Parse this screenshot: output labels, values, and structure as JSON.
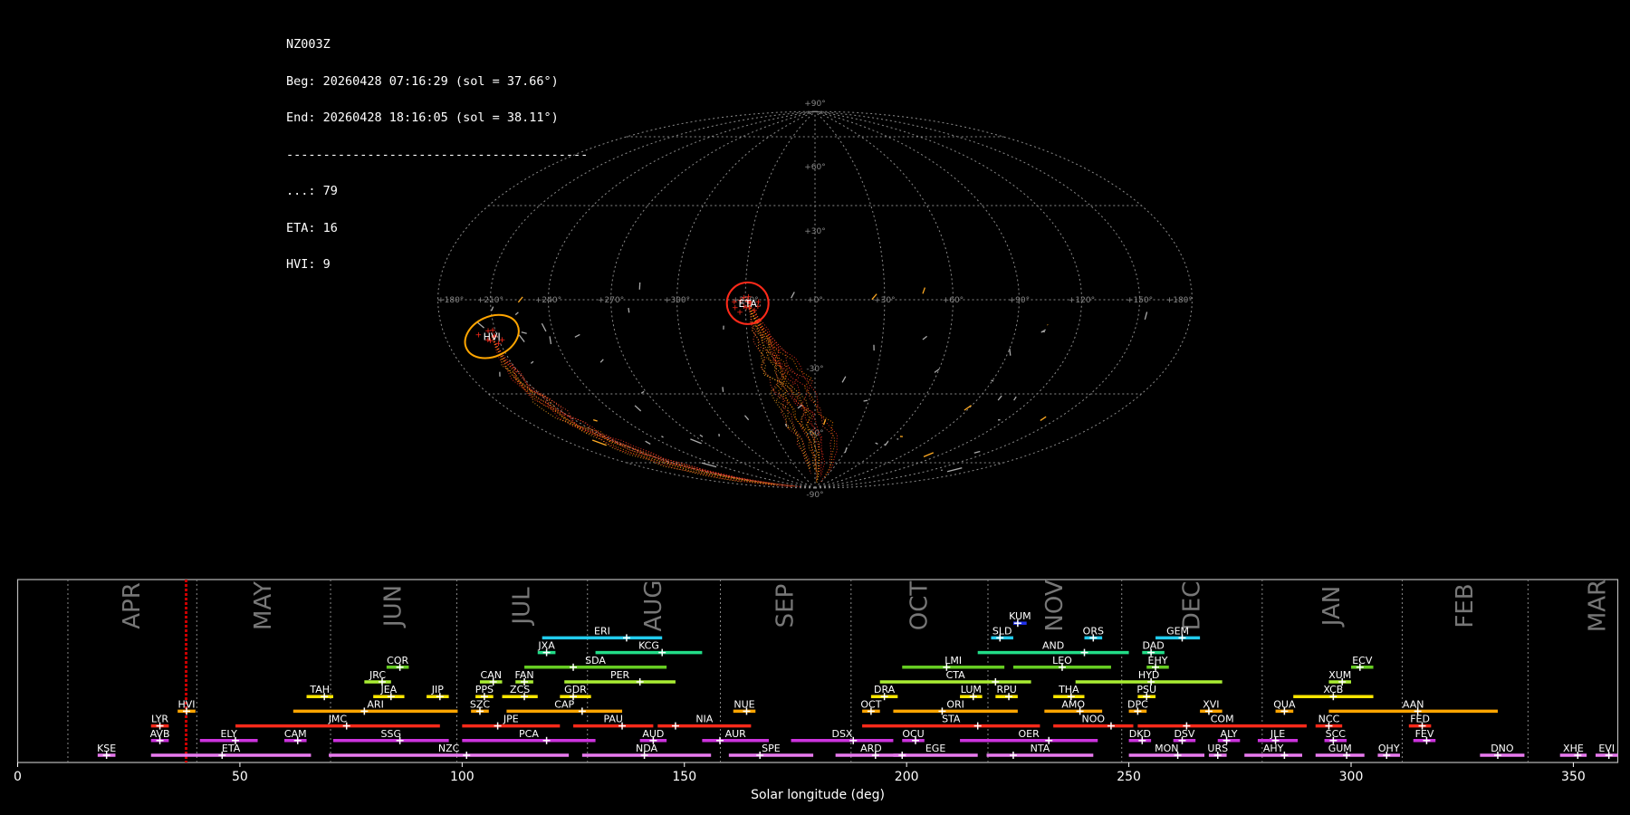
{
  "header": {
    "station": "NZ003Z",
    "begin": "Beg: 20260428 07:16:29 (sol = 37.66°)",
    "end": "End: 20260428 18:16:05 (sol = 38.11°)",
    "rule": "-----------------------------------------",
    "counts": [
      "...: 79",
      "ETA: 16",
      "HVI: 9"
    ]
  },
  "sky_map": {
    "projection": "hammer",
    "lon_labels": [
      "+180°",
      "+150°",
      "+120°",
      "+90°",
      "+60°",
      "+30°",
      "+0°",
      "+330°",
      "+300°",
      "+270°",
      "+240°",
      "+210°",
      "+180°"
    ],
    "lat_labels": [
      "+90°",
      "+60°",
      "+30°",
      "-30°",
      "-60°",
      "-90°"
    ],
    "radiants": [
      {
        "name": "ETA",
        "color": "#ff2a1a",
        "lon_deg": -29,
        "lat_deg": -1.5,
        "count": 16
      },
      {
        "name": "HVI",
        "color": "#ffa500",
        "lon_deg": -153,
        "lat_deg": -12.5,
        "count": 9
      }
    ]
  },
  "chart_data": {
    "type": "gantt",
    "xlabel": "Solar longitude (deg)",
    "xlim": [
      0,
      360
    ],
    "xticks": [
      0,
      50,
      100,
      150,
      200,
      250,
      300,
      350
    ],
    "current_sol": 37.9,
    "months": [
      {
        "name": "APR",
        "start": 11.3
      },
      {
        "name": "MAY",
        "start": 40.3
      },
      {
        "name": "JUN",
        "start": 70.4
      },
      {
        "name": "JUL",
        "start": 98.8
      },
      {
        "name": "AUG",
        "start": 128.2
      },
      {
        "name": "SEP",
        "start": 158.1
      },
      {
        "name": "OCT",
        "start": 187.5
      },
      {
        "name": "NOV",
        "start": 218.3
      },
      {
        "name": "DEC",
        "start": 248.4
      },
      {
        "name": "JAN",
        "start": 280.0
      },
      {
        "name": "FEB",
        "start": 311.5
      },
      {
        "name": "MAR",
        "start": 339.8
      }
    ],
    "showers": [
      {
        "name": "KSE",
        "row": 0,
        "start": 18,
        "end": 22,
        "peak": 20,
        "color": "#e97aef"
      },
      {
        "name": "ETA",
        "row": 0,
        "start": 30,
        "end": 66,
        "peak": 46,
        "color": "#e97aef"
      },
      {
        "name": "NZC",
        "row": 0,
        "start": 70,
        "end": 124,
        "peak": 101,
        "color": "#e97aef"
      },
      {
        "name": "NDA",
        "row": 0,
        "start": 127,
        "end": 156,
        "peak": 141,
        "color": "#e97aef"
      },
      {
        "name": "SPE",
        "row": 0,
        "start": 160,
        "end": 179,
        "peak": 167,
        "color": "#e97aef"
      },
      {
        "name": "ARD",
        "row": 0,
        "start": 184,
        "end": 200,
        "peak": 193,
        "color": "#e97aef"
      },
      {
        "name": "EGE",
        "row": 0,
        "start": 197,
        "end": 216,
        "peak": 199,
        "color": "#e97aef"
      },
      {
        "name": "NTA",
        "row": 0,
        "start": 218,
        "end": 242,
        "peak": 224,
        "color": "#e97aef"
      },
      {
        "name": "MON",
        "row": 0,
        "start": 250,
        "end": 267,
        "peak": 261,
        "color": "#e97aef"
      },
      {
        "name": "URS",
        "row": 0,
        "start": 268,
        "end": 272,
        "peak": 270,
        "color": "#e97aef"
      },
      {
        "name": "AHY",
        "row": 0,
        "start": 276,
        "end": 289,
        "peak": 285,
        "color": "#e97aef"
      },
      {
        "name": "GUM",
        "row": 0,
        "start": 292,
        "end": 303,
        "peak": 299,
        "color": "#e97aef"
      },
      {
        "name": "OHY",
        "row": 0,
        "start": 306,
        "end": 311,
        "peak": 308,
        "color": "#e97aef"
      },
      {
        "name": "DNO",
        "row": 0,
        "start": 329,
        "end": 339,
        "peak": 333,
        "color": "#e97aef"
      },
      {
        "name": "XHE",
        "row": 0,
        "start": 347,
        "end": 353,
        "peak": 351,
        "color": "#e97aef"
      },
      {
        "name": "EVI",
        "row": 0,
        "start": 355,
        "end": 360,
        "peak": 358,
        "color": "#e97aef"
      },
      {
        "name": "AVB",
        "row": 1,
        "start": 30,
        "end": 34,
        "peak": 32,
        "color": "#cc33dd"
      },
      {
        "name": "ELY",
        "row": 1,
        "start": 41,
        "end": 54,
        "peak": 49,
        "color": "#cc33dd"
      },
      {
        "name": "CAM",
        "row": 1,
        "start": 60,
        "end": 65,
        "peak": 63,
        "color": "#cc33dd"
      },
      {
        "name": "SSG",
        "row": 1,
        "start": 71,
        "end": 97,
        "peak": 86,
        "color": "#cc33dd"
      },
      {
        "name": "PCA",
        "row": 1,
        "start": 100,
        "end": 130,
        "peak": 119,
        "color": "#cc33dd"
      },
      {
        "name": "AUD",
        "row": 1,
        "start": 140,
        "end": 146,
        "peak": 143,
        "color": "#cc33dd"
      },
      {
        "name": "AUR",
        "row": 1,
        "start": 154,
        "end": 169,
        "peak": 158,
        "color": "#cc33dd"
      },
      {
        "name": "DSX",
        "row": 1,
        "start": 174,
        "end": 197,
        "peak": 188,
        "color": "#cc33dd"
      },
      {
        "name": "OCU",
        "row": 1,
        "start": 199,
        "end": 204,
        "peak": 202,
        "color": "#cc33dd"
      },
      {
        "name": "OER",
        "row": 1,
        "start": 212,
        "end": 243,
        "peak": 232,
        "color": "#cc33dd"
      },
      {
        "name": "DKD",
        "row": 1,
        "start": 250,
        "end": 255,
        "peak": 253,
        "color": "#cc33dd"
      },
      {
        "name": "DSV",
        "row": 1,
        "start": 260,
        "end": 265,
        "peak": 262,
        "color": "#cc33dd"
      },
      {
        "name": "ALY",
        "row": 1,
        "start": 270,
        "end": 275,
        "peak": 272,
        "color": "#cc33dd"
      },
      {
        "name": "JLE",
        "row": 1,
        "start": 279,
        "end": 288,
        "peak": 283,
        "color": "#cc33dd"
      },
      {
        "name": "SCC",
        "row": 1,
        "start": 294,
        "end": 299,
        "peak": 296,
        "color": "#cc33dd"
      },
      {
        "name": "FEV",
        "row": 1,
        "start": 314,
        "end": 319,
        "peak": 317,
        "color": "#cc33dd"
      },
      {
        "name": "LYR",
        "row": 2,
        "start": 30,
        "end": 34,
        "peak": 32,
        "color": "#ff2a1a"
      },
      {
        "name": "JMC",
        "row": 2,
        "start": 49,
        "end": 95,
        "peak": 74,
        "color": "#ff2a1a"
      },
      {
        "name": "JPE",
        "row": 2,
        "start": 100,
        "end": 122,
        "peak": 108,
        "color": "#ff2a1a"
      },
      {
        "name": "PAU",
        "row": 2,
        "start": 125,
        "end": 143,
        "peak": 136,
        "color": "#ff2a1a"
      },
      {
        "name": "NIA",
        "row": 2,
        "start": 144,
        "end": 165,
        "peak": 148,
        "color": "#ff2a1a"
      },
      {
        "name": "STA",
        "row": 2,
        "start": 190,
        "end": 230,
        "peak": 216,
        "color": "#ff2a1a"
      },
      {
        "name": "NOO",
        "row": 2,
        "start": 233,
        "end": 251,
        "peak": 246,
        "color": "#ff2a1a"
      },
      {
        "name": "COM",
        "row": 2,
        "start": 252,
        "end": 290,
        "peak": 263,
        "color": "#ff2a1a"
      },
      {
        "name": "NCC",
        "row": 2,
        "start": 292,
        "end": 298,
        "peak": 295,
        "color": "#ff2a1a"
      },
      {
        "name": "FED",
        "row": 2,
        "start": 313,
        "end": 318,
        "peak": 316,
        "color": "#ff2a1a"
      },
      {
        "name": "HVI",
        "row": 3,
        "start": 36,
        "end": 40,
        "peak": 38,
        "color": "#ffa500"
      },
      {
        "name": "ARI",
        "row": 3,
        "start": 62,
        "end": 99,
        "peak": 78,
        "color": "#ffa500"
      },
      {
        "name": "SZC",
        "row": 3,
        "start": 102,
        "end": 106,
        "peak": 104,
        "color": "#ffa500"
      },
      {
        "name": "CAP",
        "row": 3,
        "start": 110,
        "end": 136,
        "peak": 127,
        "color": "#ffa500"
      },
      {
        "name": "NUE",
        "row": 3,
        "start": 161,
        "end": 166,
        "peak": 164,
        "color": "#ffa500"
      },
      {
        "name": "OCT",
        "row": 3,
        "start": 190,
        "end": 194,
        "peak": 192,
        "color": "#ffa500"
      },
      {
        "name": "ORI",
        "row": 3,
        "start": 197,
        "end": 225,
        "peak": 208,
        "color": "#ffa500"
      },
      {
        "name": "AMO",
        "row": 3,
        "start": 231,
        "end": 244,
        "peak": 239,
        "color": "#ffa500"
      },
      {
        "name": "DPC",
        "row": 3,
        "start": 250,
        "end": 254,
        "peak": 252,
        "color": "#ffa500"
      },
      {
        "name": "XVI",
        "row": 3,
        "start": 266,
        "end": 271,
        "peak": 268,
        "color": "#ffa500"
      },
      {
        "name": "QUA",
        "row": 3,
        "start": 283,
        "end": 287,
        "peak": 285,
        "color": "#ffa500"
      },
      {
        "name": "AAN",
        "row": 3,
        "start": 295,
        "end": 333,
        "peak": 315,
        "color": "#ffa500"
      },
      {
        "name": "TAH",
        "row": 4,
        "start": 65,
        "end": 71,
        "peak": 69,
        "color": "#ffe600"
      },
      {
        "name": "JEA",
        "row": 4,
        "start": 80,
        "end": 87,
        "peak": 84,
        "color": "#ffe600"
      },
      {
        "name": "JIP",
        "row": 4,
        "start": 92,
        "end": 97,
        "peak": 95,
        "color": "#ffe600"
      },
      {
        "name": "PPS",
        "row": 4,
        "start": 103,
        "end": 107,
        "peak": 105,
        "color": "#ffe600"
      },
      {
        "name": "ZCS",
        "row": 4,
        "start": 109,
        "end": 117,
        "peak": 114,
        "color": "#ffe600"
      },
      {
        "name": "GDR",
        "row": 4,
        "start": 122,
        "end": 129,
        "peak": 125,
        "color": "#ffe600"
      },
      {
        "name": "DRA",
        "row": 4,
        "start": 192,
        "end": 198,
        "peak": 195,
        "color": "#ffe600"
      },
      {
        "name": "LUM",
        "row": 4,
        "start": 212,
        "end": 217,
        "peak": 215,
        "color": "#ffe600"
      },
      {
        "name": "RPU",
        "row": 4,
        "start": 220,
        "end": 225,
        "peak": 223,
        "color": "#ffe600"
      },
      {
        "name": "THA",
        "row": 4,
        "start": 233,
        "end": 240,
        "peak": 237,
        "color": "#ffe600"
      },
      {
        "name": "PSU",
        "row": 4,
        "start": 252,
        "end": 256,
        "peak": 254,
        "color": "#ffe600"
      },
      {
        "name": "XCB",
        "row": 4,
        "start": 287,
        "end": 305,
        "peak": 296,
        "color": "#ffe600"
      },
      {
        "name": "JRC",
        "row": 5,
        "start": 78,
        "end": 84,
        "peak": 82,
        "color": "#aaee33"
      },
      {
        "name": "CAN",
        "row": 5,
        "start": 104,
        "end": 109,
        "peak": 107,
        "color": "#aaee33"
      },
      {
        "name": "FAN",
        "row": 5,
        "start": 112,
        "end": 116,
        "peak": 114,
        "color": "#aaee33"
      },
      {
        "name": "PER",
        "row": 5,
        "start": 123,
        "end": 148,
        "peak": 140,
        "color": "#aaee33"
      },
      {
        "name": "CTA",
        "row": 5,
        "start": 194,
        "end": 228,
        "peak": 220,
        "color": "#aaee33"
      },
      {
        "name": "HYD",
        "row": 5,
        "start": 238,
        "end": 271,
        "peak": 255,
        "color": "#aaee33"
      },
      {
        "name": "XUM",
        "row": 5,
        "start": 295,
        "end": 300,
        "peak": 298,
        "color": "#aaee33"
      },
      {
        "name": "COR",
        "row": 6,
        "start": 83,
        "end": 88,
        "peak": 86,
        "color": "#66cc22"
      },
      {
        "name": "SDA",
        "row": 6,
        "start": 114,
        "end": 146,
        "peak": 125,
        "color": "#66cc22"
      },
      {
        "name": "LMI",
        "row": 6,
        "start": 199,
        "end": 222,
        "peak": 209,
        "color": "#66cc22"
      },
      {
        "name": "LEO",
        "row": 6,
        "start": 224,
        "end": 246,
        "peak": 235,
        "color": "#66cc22"
      },
      {
        "name": "EHY",
        "row": 6,
        "start": 254,
        "end": 259,
        "peak": 256,
        "color": "#66cc22"
      },
      {
        "name": "ECV",
        "row": 6,
        "start": 300,
        "end": 305,
        "peak": 302,
        "color": "#66cc22"
      },
      {
        "name": "JXA",
        "row": 7,
        "start": 117,
        "end": 121,
        "peak": 119,
        "color": "#22dd88"
      },
      {
        "name": "KCG",
        "row": 7,
        "start": 130,
        "end": 154,
        "peak": 145,
        "color": "#22dd88"
      },
      {
        "name": "AND",
        "row": 7,
        "start": 216,
        "end": 250,
        "peak": 240,
        "color": "#22dd88"
      },
      {
        "name": "DAD",
        "row": 7,
        "start": 253,
        "end": 258,
        "peak": 255,
        "color": "#22dd88"
      },
      {
        "name": "ERI",
        "row": 8,
        "start": 118,
        "end": 145,
        "peak": 137,
        "color": "#22ccee"
      },
      {
        "name": "SLD",
        "row": 8,
        "start": 219,
        "end": 224,
        "peak": 221,
        "color": "#22ccee"
      },
      {
        "name": "ORS",
        "row": 8,
        "start": 240,
        "end": 244,
        "peak": 242,
        "color": "#22ccee"
      },
      {
        "name": "GEM",
        "row": 8,
        "start": 256,
        "end": 266,
        "peak": 262,
        "color": "#22ccee"
      },
      {
        "name": "KUM",
        "row": 9,
        "start": 224,
        "end": 227,
        "peak": 225,
        "color": "#2233ee"
      }
    ]
  }
}
